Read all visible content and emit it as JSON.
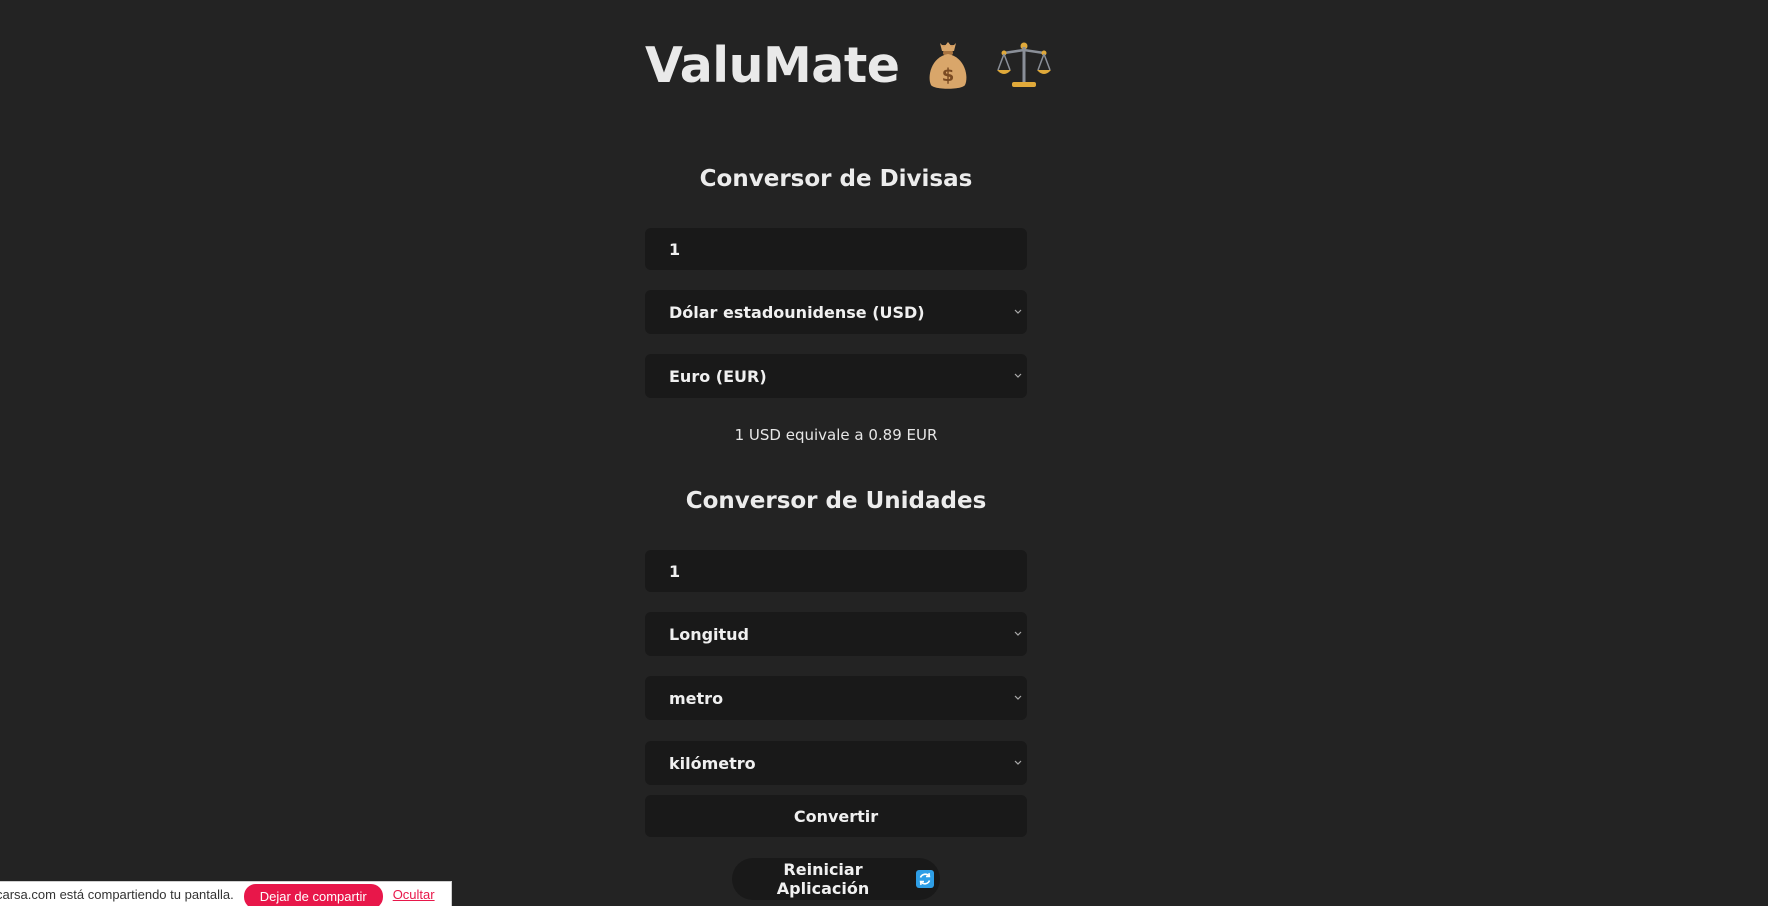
{
  "app": {
    "title": "ValuMate"
  },
  "currency": {
    "section_title": "Conversor de Divisas",
    "amount_value": "1",
    "from_currency": "Dólar estadounidense (USD)",
    "to_currency": "Euro (EUR)",
    "result": "1 USD equivale a 0.89 EUR"
  },
  "units": {
    "section_title": "Conversor de Unidades",
    "amount_value": "1",
    "category": "Longitud",
    "from_unit": "metro",
    "to_unit": "kilómetro",
    "convert_label": "Convertir"
  },
  "reset": {
    "label": "Reiniciar Aplicación"
  },
  "share_bar": {
    "message": "carsa.com está compartiendo tu pantalla.",
    "stop_label": "Dejar de compartir",
    "hide_label": "Ocultar"
  },
  "colors": {
    "background": "#232323",
    "field_background": "#191919",
    "stop_button": "#e8174a"
  },
  "icons": {
    "title_icons": [
      "money-bag-icon",
      "balance-scale-icon"
    ],
    "reset_icon": "refresh-icon"
  }
}
